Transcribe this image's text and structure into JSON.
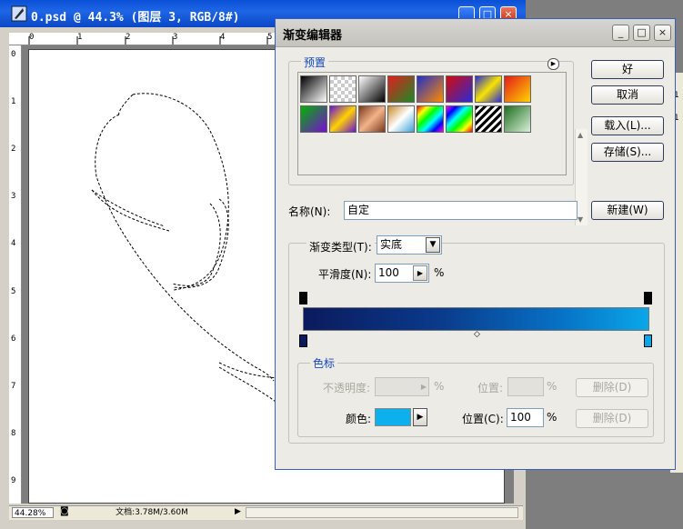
{
  "document": {
    "title": "0.psd @ 44.3% (图层 3, RGB/8#)",
    "zoom": "44.28%",
    "info": "文档:3.78M/3.60M",
    "ruler_top_numbers": [
      "0",
      "1",
      "2",
      "3",
      "4",
      "5"
    ],
    "ruler_left_numbers": [
      "0",
      "1",
      "2",
      "3",
      "4",
      "5",
      "6",
      "7",
      "8",
      "9"
    ]
  },
  "right_panel": {
    "labels": [
      "1",
      "1"
    ]
  },
  "dialog": {
    "title": "渐变编辑器",
    "presets_label": "预置",
    "buttons": {
      "ok": "好",
      "cancel": "取消",
      "load": "载入(L)...",
      "save": "存储(S)...",
      "new": "新建(W)"
    },
    "name_label": "名称(N):",
    "name_value": "自定",
    "gradient_type_label": "渐变类型(T):",
    "gradient_type_value": "实底",
    "smoothness_label": "平滑度(N):",
    "smoothness_value": "100",
    "smoothness_unit": "%",
    "stops_label": "色标",
    "opacity_label": "不透明度:",
    "opacity_unit": "%",
    "position_label": "位置:",
    "position_unit": "%",
    "delete_label": "删除(D)",
    "color_label": "颜色:",
    "color_value": "#0cb0ec",
    "position_c_label": "位置(C):",
    "position_c_value": "100",
    "position_c_unit": "%",
    "gradient_colors": [
      "#0b1a5e",
      "#0aa7e8"
    ]
  }
}
